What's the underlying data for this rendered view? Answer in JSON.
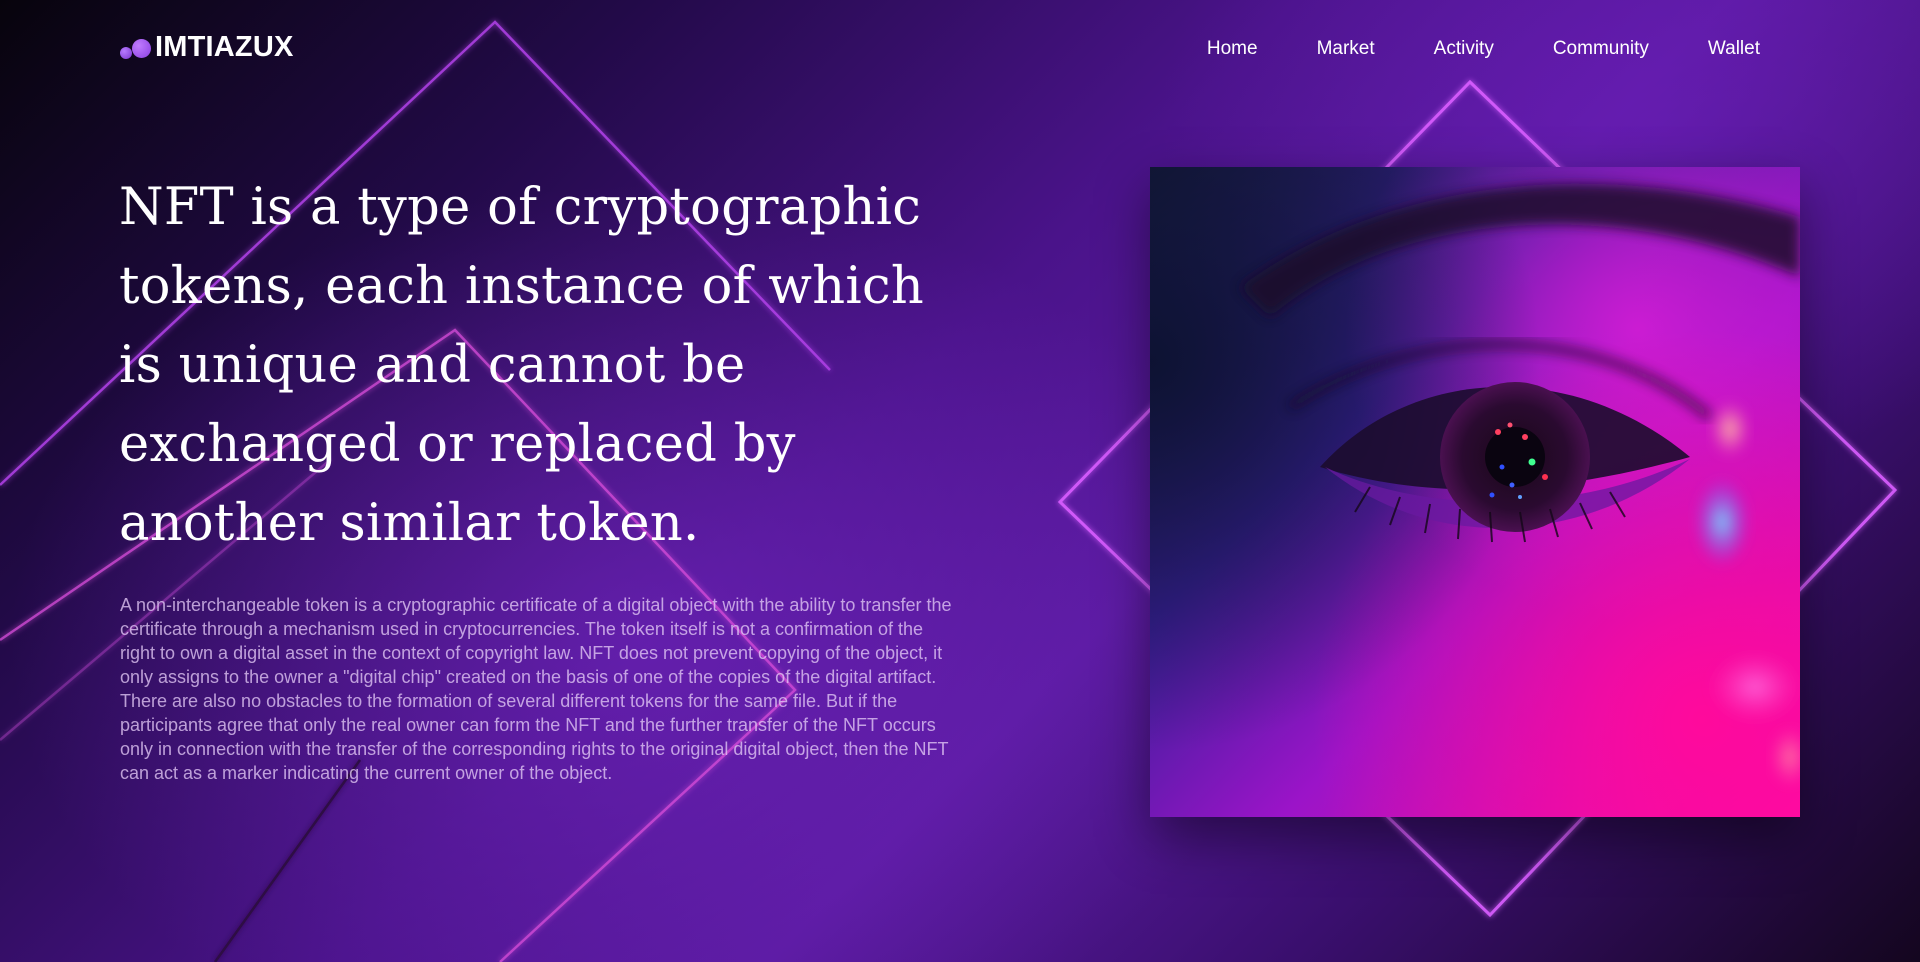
{
  "brand": {
    "name": "IMTIAZUX",
    "icon": "two-dots-logo-icon"
  },
  "nav": {
    "items": [
      {
        "label": "Home"
      },
      {
        "label": "Market"
      },
      {
        "label": "Activity"
      },
      {
        "label": "Community"
      },
      {
        "label": "Wallet"
      }
    ]
  },
  "hero": {
    "headline": "NFT is a type of cryptographic tokens, each instance of which is unique and cannot be exchanged or replaced by another similar token.",
    "description": "A non-interchangeable token is a cryptographic certificate of a digital object with the ability to transfer the certificate through a mechanism used in cryptocurrencies. The token itself is not a confirmation of the right to own a digital asset in the context of copyright law. NFT does not prevent copying of the object, it only assigns to the owner a \"digital chip\" created on the basis of one of the copies of the digital artifact. There are also no obstacles to the formation of several different tokens for the same file. But if the participants agree that only the real owner can form the NFT and the further transfer of the NFT occurs only in connection with the transfer of the corresponding rights to the original digital object, then the NFT can act as a marker indicating the current owner of the object."
  },
  "colors": {
    "background_dark": "#07040c",
    "background_purple": "#5a1aa0",
    "neon_line": "#d24bff",
    "accent_pink": "#ff1a9c",
    "accent_blue": "#3a2cff"
  },
  "art": {
    "subject": "neon-lit close-up of an eye"
  }
}
